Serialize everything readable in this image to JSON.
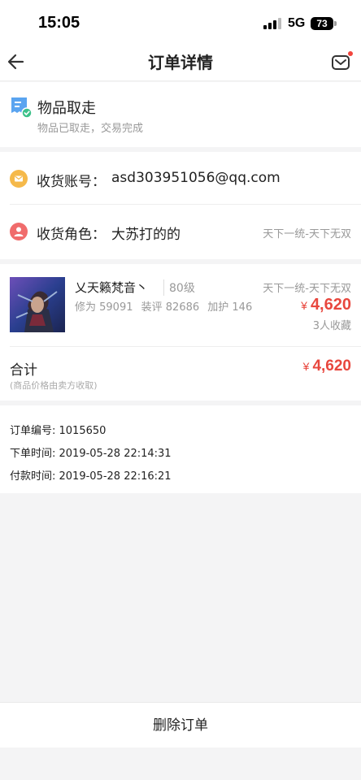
{
  "status_bar": {
    "time": "15:05",
    "network": "5G",
    "battery": "73"
  },
  "nav": {
    "title": "订单详情",
    "back_icon": "back-arrow-icon",
    "message_icon": "mail-icon"
  },
  "order_status": {
    "title": "物品取走",
    "subtitle": "物品已取走，交易完成"
  },
  "receive": {
    "account_label": "收货账号：",
    "account_value": "asd303951056@qq.com",
    "role_label": "收货角色：",
    "role_value": "大苏打的的",
    "role_server": "天下一统-天下无双"
  },
  "item": {
    "name": "乂天籁梵音丶",
    "level": "80级",
    "stats": [
      "修为 59091",
      "装评 82686",
      "加护 146"
    ],
    "server": "天下一统-天下无双",
    "currency": "¥",
    "price": "4,620",
    "favorites": "3人收藏"
  },
  "total": {
    "label": "合计",
    "note": "(商品价格由卖方收取)",
    "currency": "¥",
    "price": "4,620"
  },
  "order_info": {
    "number": "订单编号: 1015650",
    "created": "下单时间: 2019-05-28 22:14:31",
    "paid": "付款时间: 2019-05-28 22:16:21"
  },
  "actions": {
    "delete_label": "删除订单"
  },
  "colors": {
    "accent_red": "#e8473e",
    "status_blue": "#5aa4f0",
    "account_icon": "#f5b94a",
    "role_icon": "#f06c6c"
  }
}
